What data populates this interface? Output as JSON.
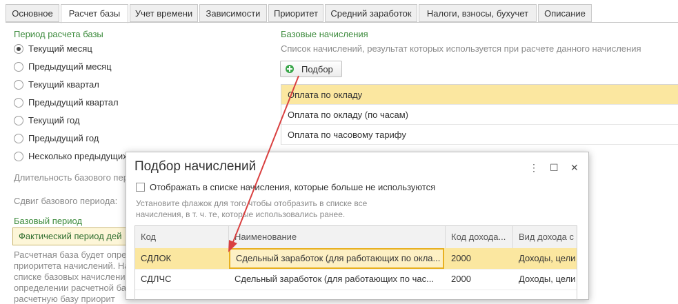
{
  "tabs": [
    {
      "label": "Основное"
    },
    {
      "label": "Расчет базы",
      "active": true
    },
    {
      "label": "Учет времени"
    },
    {
      "label": "Зависимости"
    },
    {
      "label": "Приоритет"
    },
    {
      "label": "Средний заработок"
    },
    {
      "label": "Налоги, взносы, бухучет"
    },
    {
      "label": "Описание"
    }
  ],
  "period": {
    "title": "Период расчета базы",
    "options": [
      {
        "label": "Текущий месяц",
        "checked": true
      },
      {
        "label": "Предыдущий месяц"
      },
      {
        "label": "Текущий квартал"
      },
      {
        "label": "Предыдущий квартал"
      },
      {
        "label": "Текущий год"
      },
      {
        "label": "Предыдущий год"
      },
      {
        "label": "Несколько предыдущих"
      }
    ],
    "duration_label": "Длительность базового пер",
    "shift_label": "Сдвиг базового периода:"
  },
  "base_period": {
    "title": "Базовый период",
    "value": "Фактический период дей",
    "description": [
      "Расчетная база будет опре",
      "приоритета начислений. На",
      "списке базовых начислени",
      "определении расчетной баз",
      "расчетную базу приорит"
    ]
  },
  "base_accruals": {
    "title": "Базовые начисления",
    "hint": "Список начислений, результат которых используется при расчете данного начисления",
    "pick_button": "Подбор",
    "items": [
      "Оплата по окладу",
      "Оплата по окладу (по часам)",
      "Оплата по часовому тарифу"
    ]
  },
  "dialog": {
    "title": "Подбор начислений",
    "checkbox_label": "Отображать в списке начисления, которые больше не используются",
    "hint_lines": [
      "Установите флажок для того чтобы отобразить в списке все",
      "начисления, в т. ч. те, которые использовались ранее."
    ],
    "columns": [
      "Код",
      "Наименование",
      "Код дохода...",
      "Вид дохода с"
    ],
    "rows": [
      {
        "code": "СДЛОК",
        "name": "Сдельный заработок (для работающих по окла...",
        "income_code": "2000",
        "income_type": "Доходы, цели"
      },
      {
        "code": "СДЛЧС",
        "name": "Сдельный заработок (для работающих по час...",
        "income_code": "2000",
        "income_type": "Доходы, цели"
      }
    ]
  },
  "colors": {
    "accent_green": "#3b8a3b",
    "selection": "#fbe7a0",
    "arrow": "#d94040"
  }
}
